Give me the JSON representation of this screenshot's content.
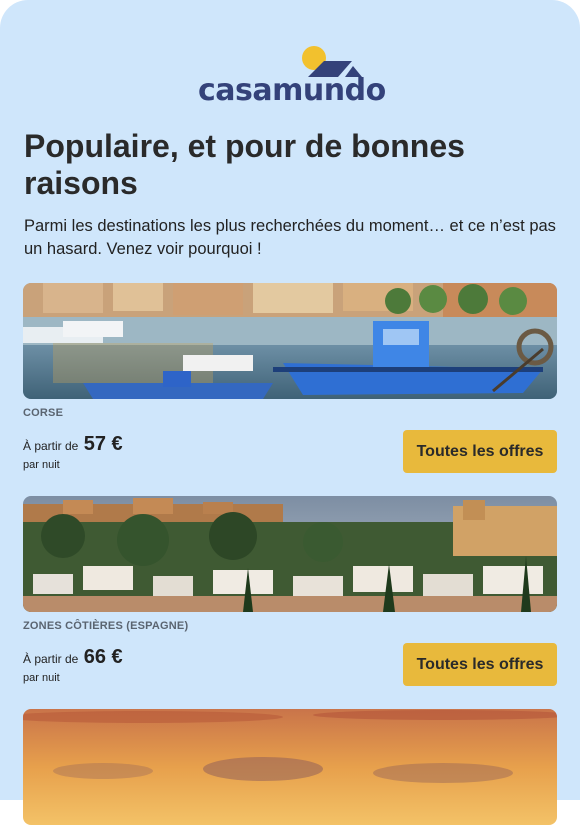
{
  "brand": {
    "name": "casamundo",
    "colors": {
      "primary": "#34427a",
      "sun": "#f2c12e",
      "accent": "#e8b93c"
    }
  },
  "headline": "Populaire, et pour de bonnes raisons",
  "intro": "Parmi les destinations les plus recherchées du moment… et ce n’est pas un hasard. Venez voir pourquoi !",
  "offers": [
    {
      "destination": "CORSE",
      "from_label": "À partir de",
      "price": "57 €",
      "per_night": "par nuit",
      "cta": "Toutes les offres",
      "image": "harbor-boats-photo"
    },
    {
      "destination": "ZONES CÔTIÈRES (ESPAGNE)",
      "from_label": "À partir de",
      "price": "66 €",
      "per_night": "par nuit",
      "cta": "Toutes les offres",
      "image": "granada-city-photo"
    },
    {
      "image": "sunset-sky-photo"
    }
  ]
}
